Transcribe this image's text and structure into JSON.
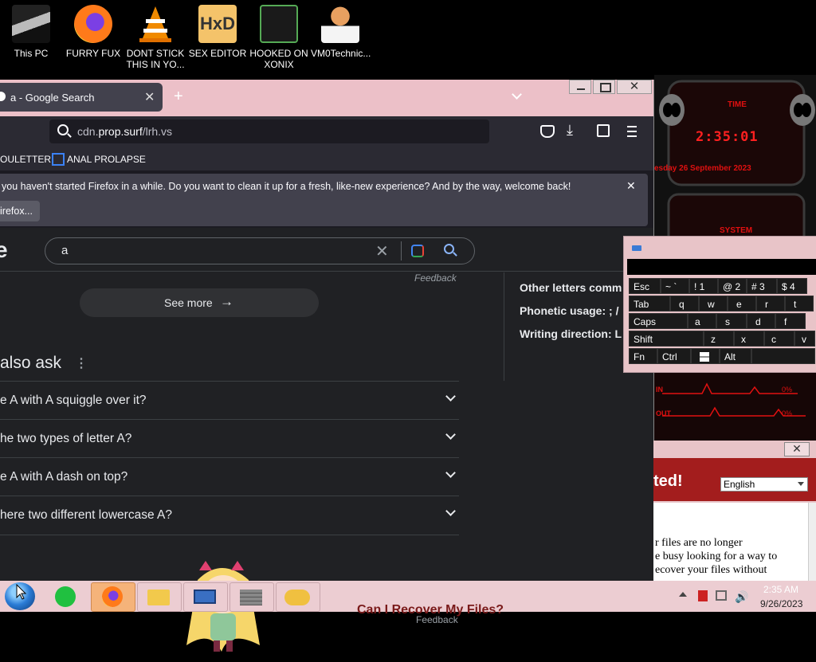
{
  "desktop": {
    "icons": [
      {
        "label": "This PC"
      },
      {
        "label": "FURRY FUX"
      },
      {
        "label": "DONT STICK THIS IN YO..."
      },
      {
        "label": "SEX EDITOR"
      },
      {
        "label": "HOOKED ON XONIX"
      },
      {
        "label": "VM0Technic..."
      }
    ]
  },
  "browser": {
    "tab_title": "a - Google Search",
    "url_domain_prefix": "cdn.",
    "url_domain": "prop.surf",
    "url_path": "/lrh.vs",
    "bookmarks": [
      "OULETTER",
      "ANAL PROLAPSE"
    ],
    "notice_text": "you haven't started Firefox in a while. Do you want to clean it up for a fresh, like-new experience? And by the way, welcome back!",
    "notice_button": "irefox...",
    "search_query": "a",
    "logo_fragment": "e",
    "feedback_1": "Feedback",
    "see_more": "See more",
    "paa_title": "also ask",
    "questions": [
      "e A with A squiggle over it?",
      "he two types of letter A?",
      "e A with A dash on top?",
      "here two different lowercase A?"
    ],
    "feedback_2": "Feedback",
    "side_panel": [
      "Other letters comm",
      "Phonetic usage: ; /",
      "Writing direction: L"
    ]
  },
  "widget": {
    "time_label": "TIME",
    "time": "2:35:01",
    "date": "esday 26 September 2023",
    "system_label": "SYSTEM",
    "in_label": "IN",
    "out_label": "OUT",
    "pct_1": "0%",
    "pct_2": "0%"
  },
  "keyboard": {
    "rows": [
      [
        "Esc",
        "~ `",
        "! 1",
        "@ 2",
        "# 3",
        "$ 4"
      ],
      [
        "Tab",
        "q",
        "w",
        "e",
        "r",
        "t"
      ],
      [
        "Caps",
        "a",
        "s",
        "d",
        "f"
      ],
      [
        "Shift",
        "z",
        "x",
        "c",
        "v"
      ],
      [
        "Fn",
        "Ctrl",
        "win",
        "Alt"
      ]
    ]
  },
  "ransom": {
    "title_fragment": "ted!",
    "language": "English",
    "body_lines": [
      "r files are no longer",
      "e busy looking for a way to",
      "ecover your files without"
    ],
    "behind_text": "Can I Recover My Files?"
  },
  "taskbar": {
    "time": "2:35 AM",
    "date": "9/26/2023"
  },
  "colors": {
    "pink_chrome": "#ecc0c8",
    "firefox_dark": "#2b2a33",
    "google_dark": "#202124",
    "alien_red": "#e01010"
  }
}
